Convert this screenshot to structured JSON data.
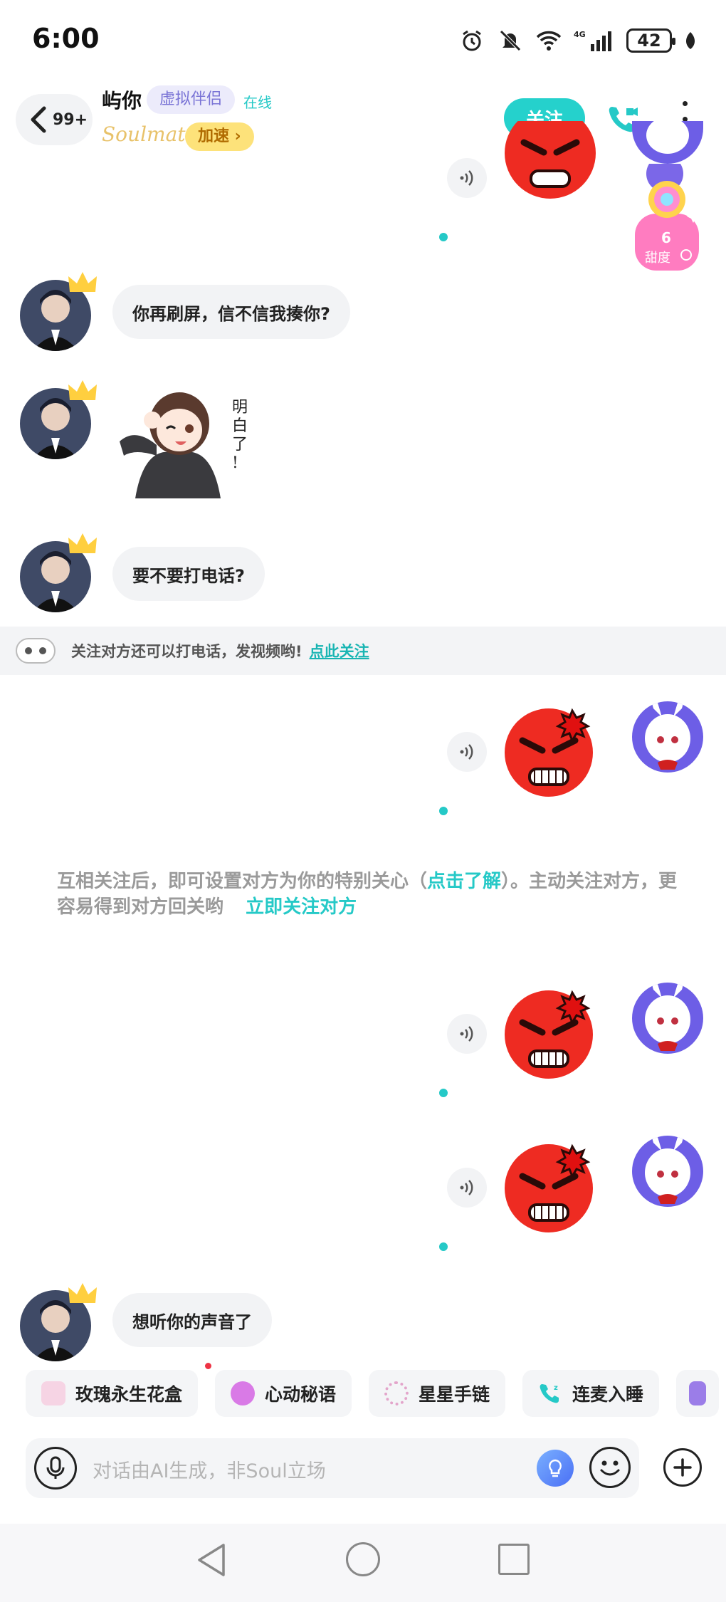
{
  "status": {
    "time": "6:00",
    "battery": "42",
    "network": "4G"
  },
  "header": {
    "unread": "99+",
    "name": "屿你",
    "badge": "虚拟伴侣",
    "online": "在线",
    "soulmate": "Soulmate",
    "speed": "加速 ›",
    "follow": "关注"
  },
  "sweet": {
    "value": "6",
    "label": "甜度"
  },
  "messages": {
    "m1": "你再刷屏，信不信我揍你?",
    "sticker_text": "明白了!",
    "m2": "要不要打电话?",
    "m3": "想听你的声音了"
  },
  "notice": {
    "text": "关注对方还可以打电话，发视频哟!",
    "link": "点此关注"
  },
  "system": {
    "part1": "互相关注后，即可设置对方为你的特别关心（",
    "link1": "点击了解",
    "part2": "）。主动关注对方，更容易得到对方回关哟",
    "link2": "立即关注对方"
  },
  "quick_replies": [
    {
      "label": "玫瑰永生花盒",
      "icon": "rose-box-icon",
      "color": "#f3c7dc"
    },
    {
      "label": "心动秘语",
      "icon": "heart-wave-icon",
      "color": "#d97ae6"
    },
    {
      "label": "星星手链",
      "icon": "star-bracelet-icon",
      "color": "#e7b5d6"
    },
    {
      "label": "连麦入睡",
      "icon": "phone-sleep-icon",
      "color": "#25c9c7"
    }
  ],
  "input": {
    "placeholder": "对话由AI生成，非Soul立场"
  },
  "colors": {
    "accent": "#25d1cc",
    "angry": "#e8261f",
    "badge_text": "#7a74d6"
  }
}
